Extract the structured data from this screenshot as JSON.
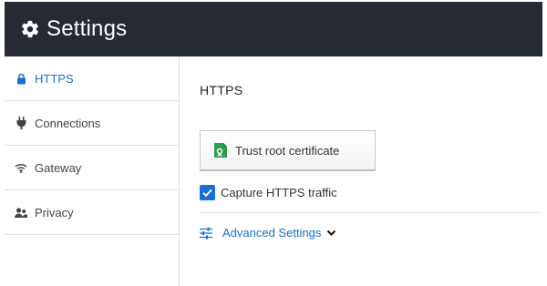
{
  "header": {
    "title": "Settings",
    "icon": "gear-icon"
  },
  "sidebar": {
    "items": [
      {
        "label": "HTTPS",
        "icon": "lock-icon",
        "active": true
      },
      {
        "label": "Connections",
        "icon": "plug-icon",
        "active": false
      },
      {
        "label": "Gateway",
        "icon": "wifi-icon",
        "active": false
      },
      {
        "label": "Privacy",
        "icon": "users-icon",
        "active": false
      }
    ]
  },
  "main": {
    "section_title": "HTTPS",
    "trust_button": {
      "label": "Trust root certificate",
      "icon": "certificate-icon"
    },
    "capture_checkbox": {
      "label": "Capture HTTPS traffic",
      "checked": true
    },
    "advanced": {
      "label": "Advanced Settings",
      "icon": "sliders-icon",
      "chevron": "chevron-down-icon"
    }
  },
  "colors": {
    "header_bg": "#262a33",
    "accent": "#1a6fd6",
    "certificate_green": "#2e9e4a"
  }
}
